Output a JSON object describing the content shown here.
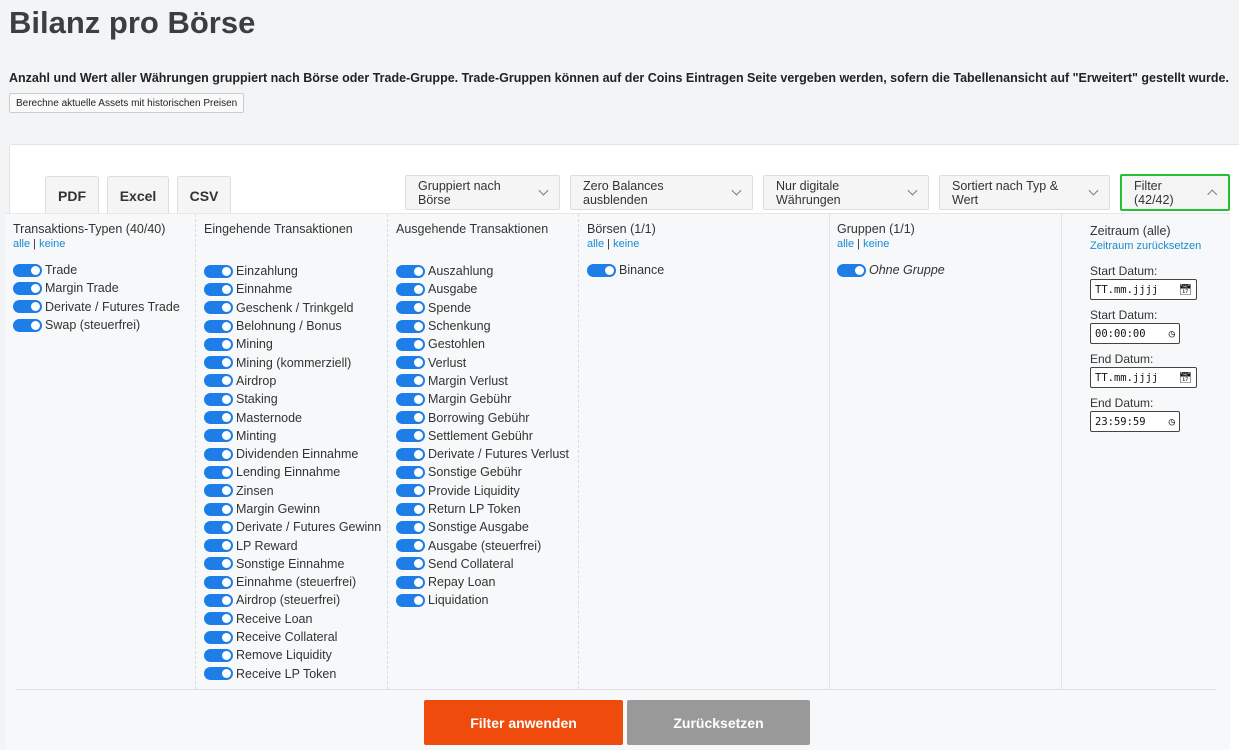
{
  "title": "Bilanz pro Börse",
  "description": "Anzahl und Wert aller Währungen gruppiert nach Börse oder Trade-Gruppe. Trade-Gruppen können auf der Coins Eintragen Seite vergeben werden, sofern die Tabellenansicht auf \"Erweitert\" gestellt wurde.",
  "calc_button": "Berechne aktuelle Assets mit historischen Preisen",
  "export": {
    "pdf": "PDF",
    "excel": "Excel",
    "csv": "CSV"
  },
  "toolbar": {
    "group": "Gruppiert nach Börse",
    "zero": "Zero Balances ausblenden",
    "digital": "Nur digitale Währungen",
    "sort": "Sortiert nach Typ & Wert",
    "filter": "Filter (42/42)"
  },
  "all_label": "alle",
  "none_label": "keine",
  "columns": [
    {
      "title": "Transaktions-Typen (40/40)",
      "items": [
        "Trade",
        "Margin Trade",
        "Derivate / Futures Trade",
        "Swap (steuerfrei)"
      ]
    },
    {
      "title": "Eingehende Transaktionen",
      "items": [
        "Einzahlung",
        "Einnahme",
        "Geschenk / Trinkgeld",
        "Belohnung / Bonus",
        "Mining",
        "Mining (kommerziell)",
        "Airdrop",
        "Staking",
        "Masternode",
        "Minting",
        "Dividenden Einnahme",
        "Lending Einnahme",
        "Zinsen",
        "Margin Gewinn",
        "Derivate / Futures Gewinn",
        "LP Reward",
        "Sonstige Einnahme",
        "Einnahme (steuerfrei)",
        "Airdrop (steuerfrei)",
        "Receive Loan",
        "Receive Collateral",
        "Remove Liquidity",
        "Receive LP Token"
      ]
    },
    {
      "title": "Ausgehende Transaktionen",
      "items": [
        "Auszahlung",
        "Ausgabe",
        "Spende",
        "Schenkung",
        "Gestohlen",
        "Verlust",
        "Margin Verlust",
        "Margin Gebühr",
        "Borrowing Gebühr",
        "Settlement Gebühr",
        "Derivate / Futures Verlust",
        "Sonstige Gebühr",
        "Provide Liquidity",
        "Return LP Token",
        "Sonstige Ausgabe",
        "Ausgabe (steuerfrei)",
        "Send Collateral",
        "Repay Loan",
        "Liquidation"
      ]
    },
    {
      "title": "Börsen (1/1)",
      "items": [
        "Binance"
      ]
    },
    {
      "title": "Gruppen (1/1)",
      "items": [
        "Ohne Gruppe"
      ]
    }
  ],
  "zeitraum": {
    "title": "Zeitraum (alle)",
    "reset": "Zeitraum zurücksetzen",
    "start_date_label": "Start Datum:",
    "start_date_value": "TT.mm.jjjj",
    "start_time_label": "Start Datum:",
    "start_time_value": "00:00:00",
    "end_date_label": "End Datum:",
    "end_date_value": "TT.mm.jjjj",
    "end_time_label": "End Datum:",
    "end_time_value": "23:59:59"
  },
  "apply_button": "Filter anwenden",
  "reset_button": "Zurücksetzen",
  "accent": "#1e7ee8",
  "apply_color": "#ef4b0c",
  "highlight": "#22c032"
}
